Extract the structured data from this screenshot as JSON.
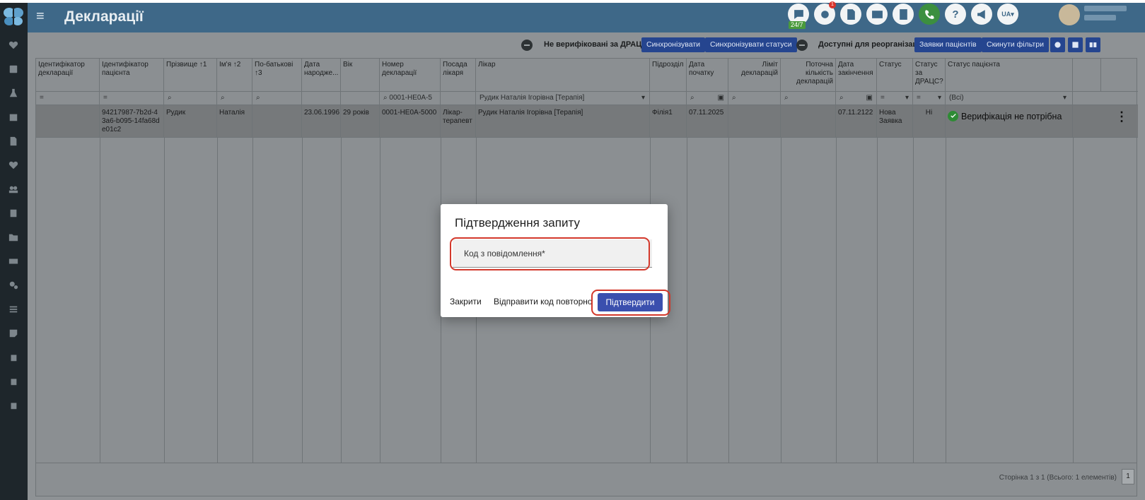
{
  "header": {
    "title": "Декларації",
    "chat_badge": "24/7",
    "notif_count": "1",
    "help_label": "?",
    "lang": "UA▾"
  },
  "toolbar": {
    "not_verified_label": "Не верифіковані за ДРАЦС",
    "sync_label": "Синхронізувати",
    "sync_status_label": "Синхронізувати статуси",
    "reorg_label": "Доступні для реорганізації",
    "patient_requests_label": "Заявки пацієнтів",
    "reset_filters_label": "Скинути фільтри"
  },
  "table": {
    "columns": [
      "Ідентифікатор декларації",
      "Ідентифікатор пацієнта",
      "Прізвище ↑1",
      "Ім'я ↑2",
      "По-батькові ↑3",
      "Дата народже...",
      "Вік",
      "Номер декларації",
      "Посада лікаря",
      "Лікар",
      "Підрозділ",
      "Дата початку",
      "Ліміт декларацій",
      "Поточна кількість декларацій",
      "Дата закінчення",
      "Статус",
      "Статус за ДРАЦС?",
      "Статус пацієнта"
    ],
    "filters": {
      "eq1": "=",
      "eq2": "=",
      "decl_number": "0001-HE0A-5",
      "doctor": "Рудик Наталія Ігорівна [Терапія]",
      "status_eq": "=",
      "drac_eq": "=",
      "patient_status": "(Всі)"
    },
    "row": {
      "decl_id": "",
      "patient_id": "94217987-7b2d-43a6-b095-14fa68de01c2",
      "last_name": "Рудик",
      "first_name": "Наталія",
      "patronymic": "",
      "birth_date": "23.06.1996",
      "age": "29 років",
      "decl_number": "0001-HE0A-5000",
      "doctor_position": "Лікар-терапевт",
      "doctor": "Рудик Наталія Ігорівна [Терапія]",
      "division": "Філія1",
      "start_date": "07.11.2025",
      "limit": "",
      "current_count": "",
      "end_date": "07.11.2122",
      "status": "Нова Заявка",
      "drac_status": "Ні",
      "patient_status": "Верифікація не потрібна"
    },
    "pager": {
      "summary": "Сторінка 1 з 1 (Всього: 1 елементів)",
      "page": "1"
    }
  },
  "modal": {
    "title": "Підтвердження запиту",
    "code_label": "Код з повідомлення*",
    "close_label": "Закрити",
    "resend_label": "Відправити код повторно",
    "confirm_label": "Підтвердити"
  },
  "colors": {
    "header_bg": "#3e6888",
    "sidebar_bg": "#1e262b",
    "button_bg": "#25458f",
    "confirm_bg": "#3a4fae",
    "highlight": "#d3382b",
    "status_ok": "#2e8b34"
  }
}
